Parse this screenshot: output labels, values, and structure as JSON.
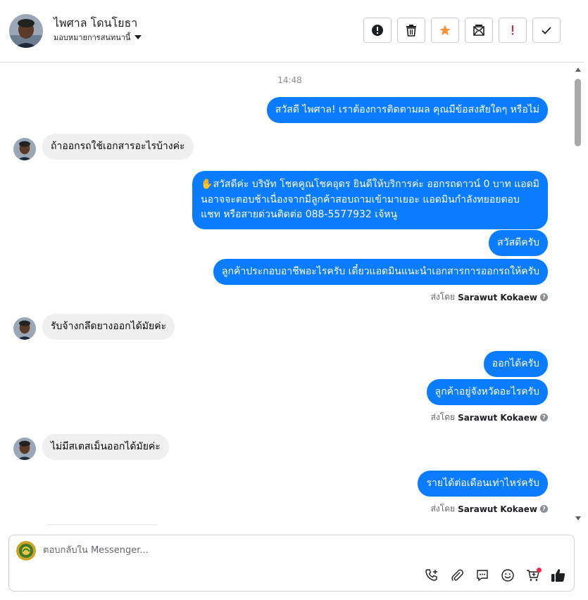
{
  "header": {
    "contact_name": "ไพศาล โดนโยธา",
    "assign_label": "มอบหมายการสนทนานี้"
  },
  "toolbar": {
    "buttons": [
      "spam-icon",
      "trash-icon",
      "star-icon",
      "mark-unread-icon",
      "important-icon",
      "done-icon"
    ],
    "star_color": "#f7923a",
    "important_color": "#e41e3f"
  },
  "conversation": {
    "timestamp": "14:48",
    "messages": [
      {
        "dir": "out",
        "text": "สวัสดี ไพศาล! เราต้องการติดตามผล คุณมีข้อสงสัยใดๆ หรือไม่"
      },
      {
        "dir": "in",
        "text": "ถ้าออกรถใช้เอกสารอะไรบ้างค่ะ"
      },
      {
        "dir": "out",
        "lines": [
          "✋สวัสดีค่ะ บริษัท โชคคูณโชคอุดร ยินดีให้บริการค่ะ ออกรถดาวน์ 0 บาท แอดมิ",
          "นอาจจะตอบช้าเนื่องจากมีลูกค้าสอบถามเข้ามาเยอะ แอดมินกำลังทยอยตอบ",
          "แชท หรือสายด่วนติดต่อ 088-5577932 เจ้หนู"
        ]
      },
      {
        "dir": "out",
        "text": "สวัสดีครับ"
      },
      {
        "dir": "out",
        "text": "ลูกค้าประกอบอาชีพอะไรครับ เดี๋ยวแอดมินแนะนำเอกสารการออกรถให้ครับ"
      },
      {
        "dir": "in",
        "text": "รับจ้างกลึดยางออกได้มัยค่ะ"
      },
      {
        "dir": "out",
        "text": "ออกได้ครับ"
      },
      {
        "dir": "out",
        "text": "ลูกค้าอยู่จังหวัดอะไรครับ"
      },
      {
        "dir": "in",
        "text": "ไม่มีสเตสเม็นออกได้มัยค่ะ"
      },
      {
        "dir": "out",
        "text": "รายได้ต่อเดือนเท่าไหร่ครับ"
      }
    ],
    "sent_by_prefix": "ส่งโดย",
    "sent_by_name": "Sarawut Kokaew",
    "help_glyph": "?"
  },
  "composer": {
    "placeholder": "ตอบกลับใน Messenger...",
    "icons": [
      "call-add-icon",
      "attach-icon",
      "saved-replies-icon",
      "emoji-icon",
      "cart-icon",
      "like-icon"
    ]
  },
  "colors": {
    "outgoing_bubble": "#0a7cff",
    "incoming_bubble": "#f0f0f0"
  }
}
